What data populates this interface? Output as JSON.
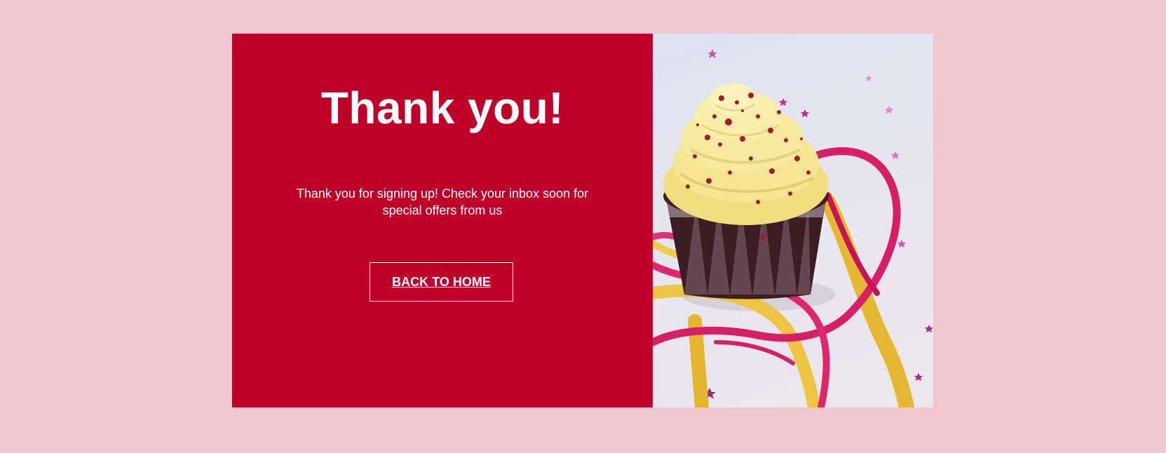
{
  "page": {
    "background_color": "#f1c7cf",
    "panel_color": "#bf0029"
  },
  "main": {
    "title": "Thank you!",
    "message": "Thank you for signing up! Check your inbox soon for special offers from us",
    "back_button_label": "BACK TO HOME"
  },
  "image": {
    "subject": "cupcake-with-ribbons-photo"
  }
}
